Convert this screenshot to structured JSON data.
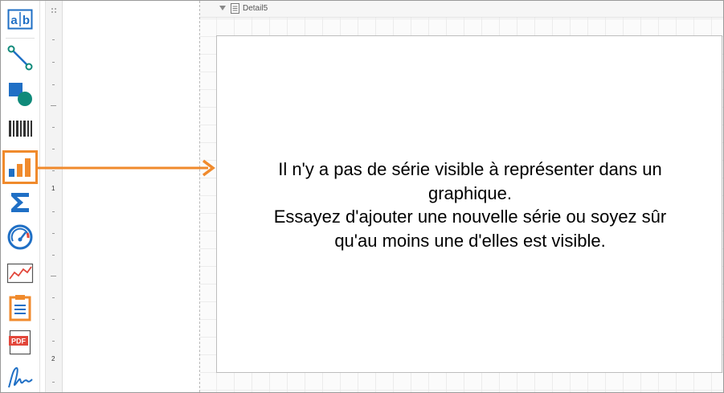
{
  "band": {
    "label": "Detail5"
  },
  "ruler": {
    "marks": [
      "1",
      "2"
    ]
  },
  "toolbox": {
    "items": [
      {
        "name": "label-tool-icon"
      },
      {
        "name": "line-tool-icon"
      },
      {
        "name": "shape-tool-icon"
      },
      {
        "name": "barcode-tool-icon"
      },
      {
        "name": "chart-tool-icon",
        "selected": true
      },
      {
        "name": "summary-tool-icon"
      },
      {
        "name": "gauge-tool-icon"
      },
      {
        "name": "sparkline-tool-icon"
      },
      {
        "name": "subreport-tool-icon"
      },
      {
        "name": "pdf-content-tool-icon",
        "text": "PDF"
      },
      {
        "name": "signature-tool-icon"
      }
    ]
  },
  "chart": {
    "message_lines": [
      "Il n'y a pas de série visible à représenter dans un",
      "graphique.",
      "Essayez d'ajouter une nouvelle série ou soyez sûr",
      "qu'au moins une d'elles est visible."
    ]
  },
  "colors": {
    "accent": "#f08a2c",
    "tool_blue": "#1f6fc5",
    "tool_teal": "#0f8a7a"
  }
}
